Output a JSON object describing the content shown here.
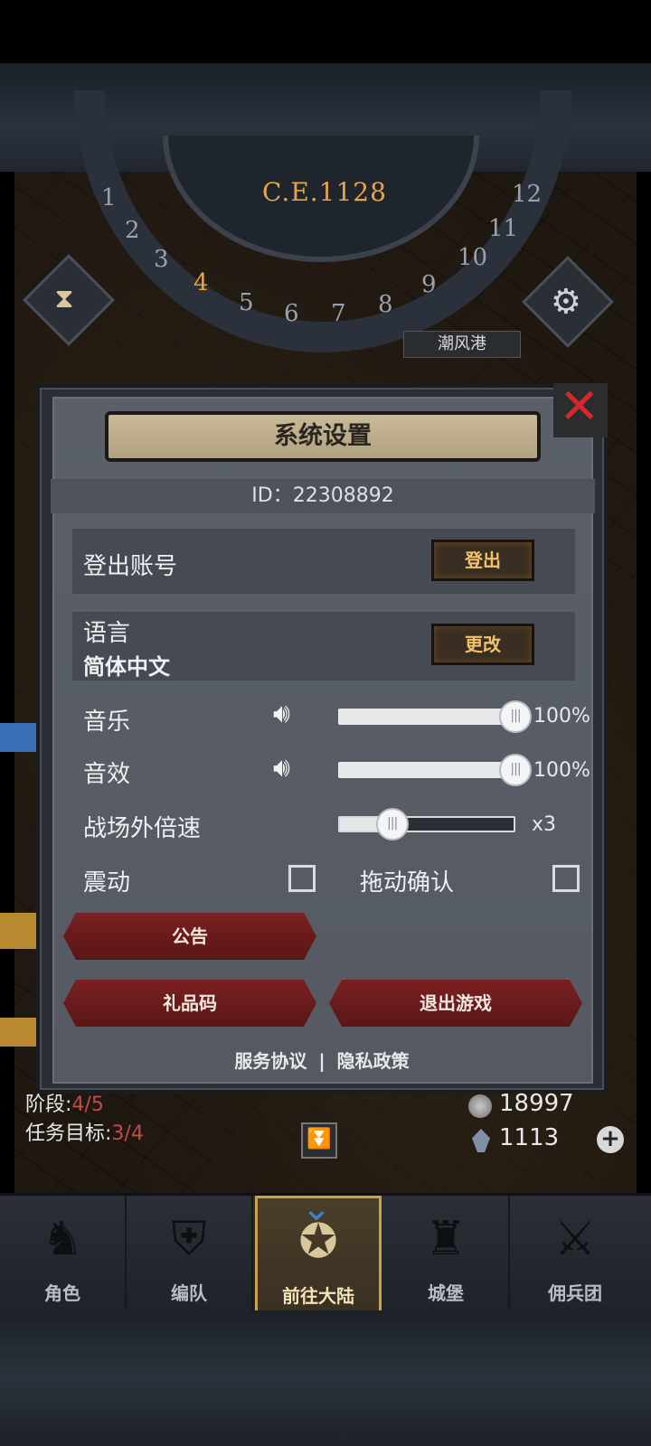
{
  "map": {
    "year": "C.E.1128",
    "ring_numbers": [
      "1",
      "2",
      "3",
      "4",
      "5",
      "6",
      "7",
      "8",
      "9",
      "10",
      "11",
      "12"
    ],
    "active_number": "4",
    "port_label": "潮风港"
  },
  "dialog": {
    "title": "系统设置",
    "id_text": "ID：22308892",
    "logout_label": "登出账号",
    "logout_button": "登出",
    "language_label": "语言",
    "language_value": "简体中文",
    "language_button": "更改",
    "music_label": "音乐",
    "music_value": "100%",
    "music_level": 1.0,
    "sfx_label": "音效",
    "sfx_value": "100%",
    "sfx_level": 1.0,
    "speed_label": "战场外倍速",
    "speed_value": "x3",
    "speed_level": 0.3,
    "vibrate_label": "震动",
    "vibrate_checked": false,
    "drag_confirm_label": "拖动确认",
    "drag_confirm_checked": false,
    "notice_button": "公告",
    "gift_code_button": "礼品码",
    "quit_button": "退出游戏",
    "terms_link": "服务协议",
    "privacy_link": "隐私政策",
    "separator": "|"
  },
  "hud": {
    "stage_label": "阶段:",
    "stage_value": "4/5",
    "task_label": "任务目标:",
    "task_value": "3/4",
    "silver": "18997",
    "crystal": "1113"
  },
  "nav": {
    "items": [
      {
        "label": "角色",
        "icon": "knight-icon"
      },
      {
        "label": "编队",
        "icon": "team-icon"
      },
      {
        "label": "前往大陆",
        "icon": "compass-icon"
      },
      {
        "label": "城堡",
        "icon": "castle-icon"
      },
      {
        "label": "佣兵团",
        "icon": "mercenary-icon"
      }
    ],
    "active_index": 2
  },
  "colors": {
    "accent_gold": "#f2c26a",
    "close_red": "#d7262a",
    "year_orange": "#e7a44a",
    "nav_arrow_blue": "#3f7fd6"
  }
}
